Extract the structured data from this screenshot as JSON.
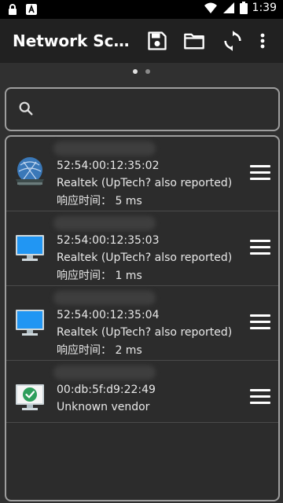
{
  "status_bar": {
    "time": "1:39",
    "left_icons": [
      "lock-icon",
      "a-notification-icon"
    ],
    "right_icons": [
      "wifi-icon",
      "signal-icon",
      "battery-icon"
    ]
  },
  "app_bar": {
    "title": "Network Scanner",
    "actions": [
      "save-icon",
      "folder-icon",
      "refresh-icon",
      "more-vert-icon"
    ]
  },
  "pager": {
    "count": 2,
    "active_index": 0
  },
  "search": {
    "placeholder": "",
    "value": ""
  },
  "devices": [
    {
      "mac": "52:54:00:12:35:02",
      "vendor": "Realtek (UpTech? also reported)",
      "response": "响应时间：  5 ms",
      "icon": "router-icon"
    },
    {
      "mac": "52:54:00:12:35:03",
      "vendor": "Realtek (UpTech? also reported)",
      "response": "响应时间：  1 ms",
      "icon": "monitor-icon"
    },
    {
      "mac": "52:54:00:12:35:04",
      "vendor": "Realtek (UpTech? also reported)",
      "response": "响应时间：  2 ms",
      "icon": "monitor-icon"
    },
    {
      "mac": "00:db:5f:d9:22:49",
      "vendor": "Unknown vendor",
      "response": "",
      "icon": "this-device-check-icon"
    }
  ],
  "colors": {
    "background": "#303030",
    "app_bar": "#212121",
    "status_bar": "#000000",
    "border": "#9e9e9e",
    "monitor_blue": "#2196f3",
    "check_green": "#2e9e5b"
  }
}
